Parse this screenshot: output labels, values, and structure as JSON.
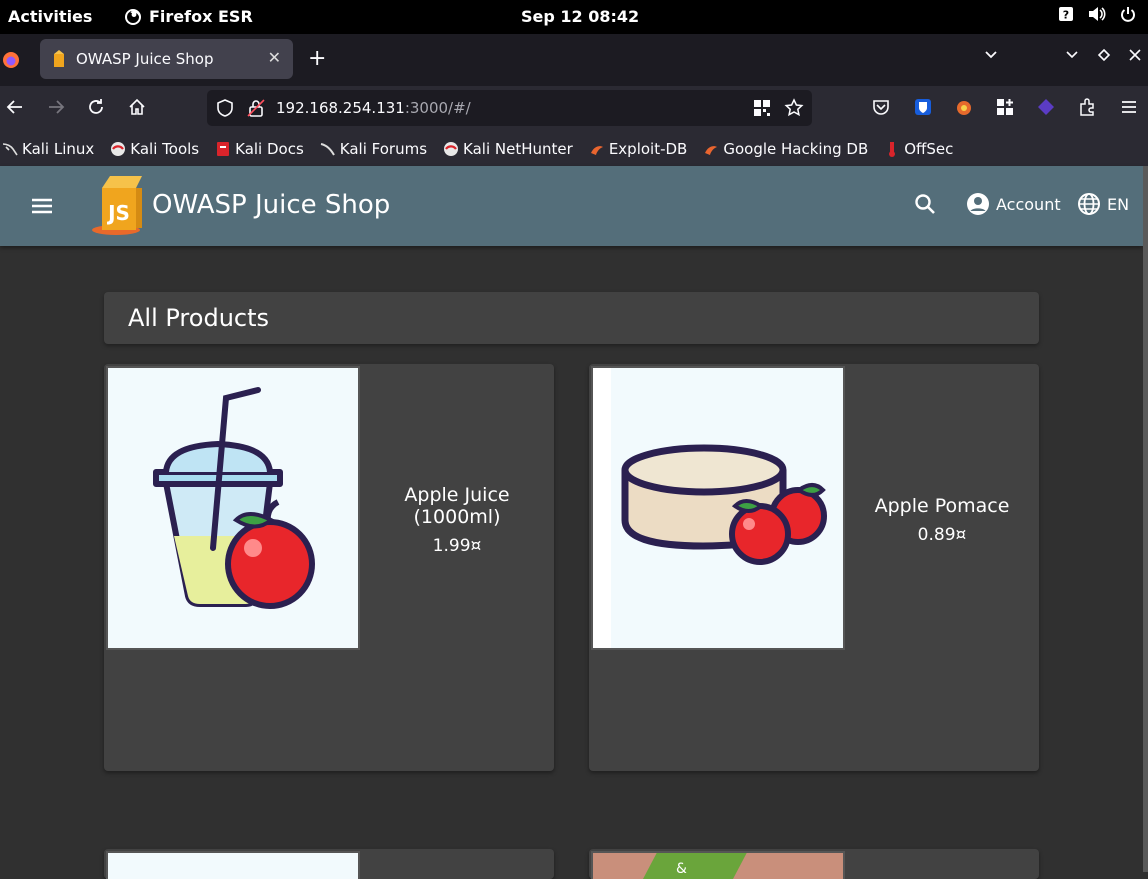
{
  "os": {
    "activities": "Activities",
    "app_name": "Firefox ESR",
    "clock": "Sep 12  08:42"
  },
  "browser": {
    "tab_title": "OWASP Juice Shop",
    "url_host": "192.168.254.131",
    "url_rest": ":3000/#/",
    "bookmarks": [
      "Kali Linux",
      "Kali Tools",
      "Kali Docs",
      "Kali Forums",
      "Kali NetHunter",
      "Exploit-DB",
      "Google Hacking DB",
      "OffSec"
    ]
  },
  "app": {
    "title": "OWASP Juice Shop",
    "account_label": "Account",
    "language_label": "EN",
    "header_color": "#546e7a"
  },
  "content": {
    "section_title": "All Products",
    "products": [
      {
        "name": "Apple Juice (1000ml)",
        "price": "1.99¤"
      },
      {
        "name": "Apple Pomace",
        "price": "0.89¤"
      }
    ]
  }
}
